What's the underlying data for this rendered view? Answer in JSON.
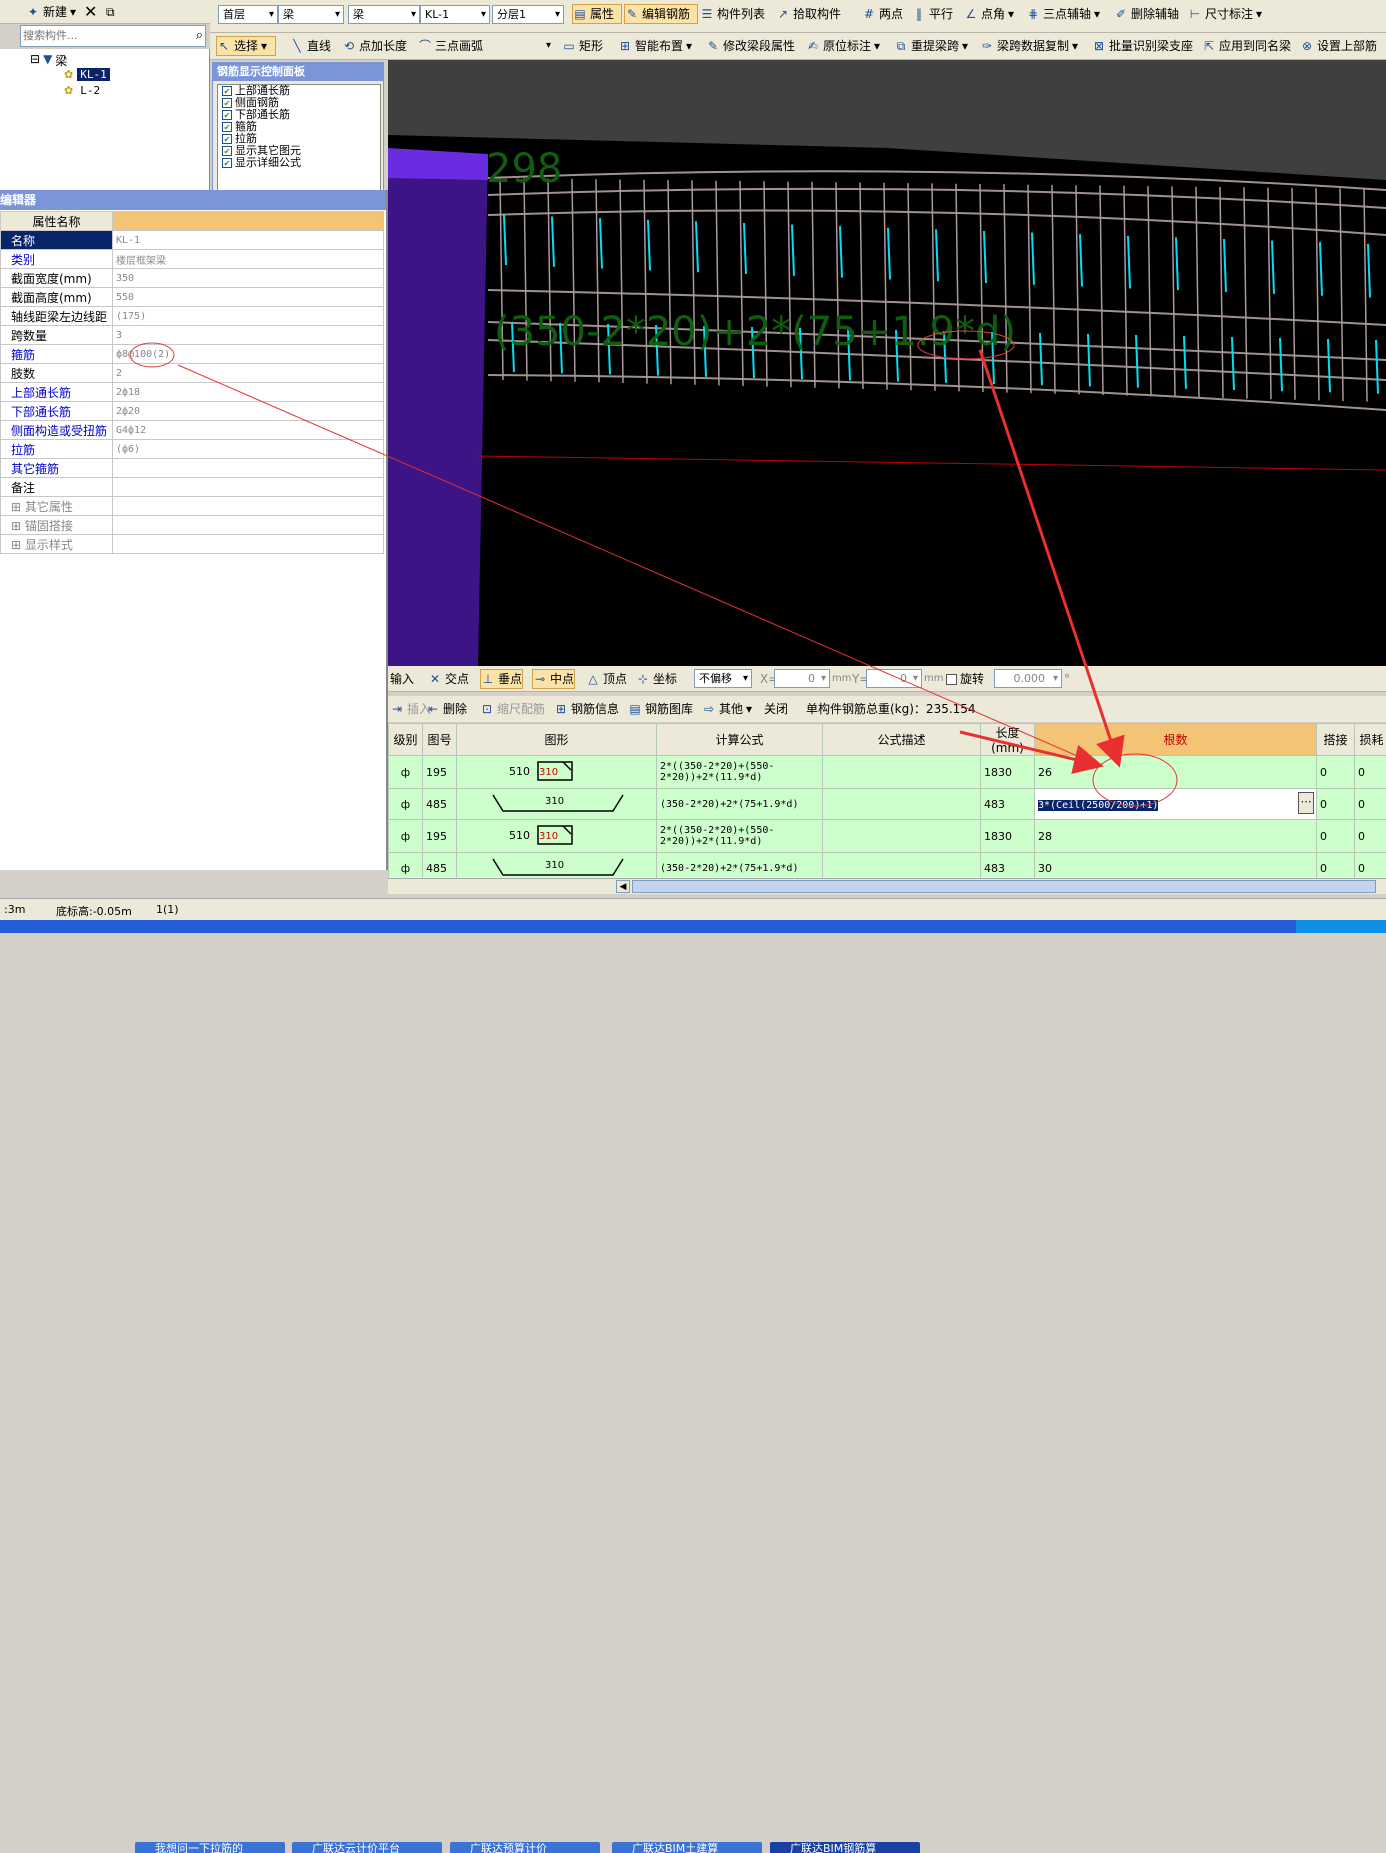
{
  "left_toolbar": {
    "new_label": "新建",
    "search_placeholder": "搜索构件..."
  },
  "tree": {
    "root": "梁",
    "items": [
      "KL-1",
      "L-2"
    ]
  },
  "toolbar1": {
    "floor": "首层",
    "cat1": "梁",
    "cat2": "梁",
    "component": "KL-1",
    "layer": "分层1",
    "attr": "属性",
    "edit_rebar": "编辑钢筋",
    "comp_list": "构件列表",
    "pick": "拾取构件",
    "two_point": "两点",
    "parallel": "平行",
    "point_angle": "点角",
    "three_point_aux": "三点辅轴",
    "delete_aux": "删除辅轴",
    "dimension": "尺寸标注"
  },
  "toolbar2": {
    "select": "选择",
    "line": "直线",
    "point_len": "点加长度",
    "arc": "三点画弧",
    "rect": "矩形",
    "smart": "智能布置",
    "modify_span": "修改梁段属性",
    "origin_mark": "原位标注",
    "re_extract": "重提梁跨",
    "copy_span": "梁跨数据复制",
    "batch_support": "批量识别梁支座",
    "apply_same": "应用到同名梁",
    "set_upper": "设置上部筋"
  },
  "control_panel": {
    "title": "钢筋显示控制面板",
    "items": [
      "上部通长筋",
      "侧面钢筋",
      "下部通长筋",
      "箍筋",
      "拉筋",
      "显示其它图元",
      "显示详细公式"
    ]
  },
  "prop_editor": {
    "title": "编辑器",
    "header": "属性名称",
    "rows": [
      {
        "name": "名称",
        "value": "KL-1"
      },
      {
        "name": "类别",
        "value": "楼层框架梁"
      },
      {
        "name": "截面宽度(mm)",
        "value": "350"
      },
      {
        "name": "截面高度(mm)",
        "value": "550"
      },
      {
        "name": "轴线距梁左边线距",
        "value": "(175)"
      },
      {
        "name": "跨数量",
        "value": "3"
      },
      {
        "name": "箍筋",
        "value": "ф8@100(2)"
      },
      {
        "name": "肢数",
        "value": "2"
      },
      {
        "name": "上部通长筋",
        "value": "2ф18"
      },
      {
        "name": "下部通长筋",
        "value": "2ф20"
      },
      {
        "name": "侧面构造或受扭筋",
        "value": "G4ф12"
      },
      {
        "name": "拉筋",
        "value": "(ф6)"
      },
      {
        "name": "其它箍筋",
        "value": ""
      },
      {
        "name": "备注",
        "value": ""
      },
      {
        "name": "其它属性",
        "value": ""
      },
      {
        "name": "锚固搭接",
        "value": ""
      },
      {
        "name": "显示样式",
        "value": ""
      }
    ]
  },
  "canvas": {
    "label_top": "298",
    "formula": "(350-2*20)+2*(75+1.9*d)"
  },
  "snap_bar": {
    "input": "输入",
    "intersect": "交点",
    "perp": "垂点",
    "mid": "中点",
    "vertex": "顶点",
    "coord": "坐标",
    "no_offset": "不偏移",
    "x_label": "X=",
    "x_val": "0",
    "mm1": "mm",
    "y_label": "Y=",
    "y_val": "0",
    "mm2": "mm",
    "rotate": "旋转",
    "rot_val": "0.000",
    "deg": "°"
  },
  "rebar_bar": {
    "insert": "插入",
    "delete": "删除",
    "scale": "缩尺配筋",
    "rebar_info": "钢筋信息",
    "rebar_lib": "钢筋图库",
    "other": "其他",
    "close": "关闭",
    "total": "单构件钢筋总重(kg)：235.154"
  },
  "grid": {
    "headers": [
      "级别",
      "图号",
      "图形",
      "计算公式",
      "公式描述",
      "长度(mm)",
      "根数",
      "搭接",
      "损耗"
    ],
    "rows": [
      {
        "grade": "ф",
        "fig": "195",
        "s1": "510",
        "s2": "310",
        "formula": "2*((350-2*20)+(550-2*20))+2*(11.9*d)",
        "len": "1830",
        "count": "26",
        "lap": "0",
        "loss": "0"
      },
      {
        "grade": "ф",
        "fig": "485",
        "s1": "",
        "s2": "310",
        "formula": "(350-2*20)+2*(75+1.9*d)",
        "len": "483",
        "count": "3*(Ceil(2500/200)+1)",
        "lap": "0",
        "loss": "0"
      },
      {
        "grade": "ф",
        "fig": "195",
        "s1": "510",
        "s2": "310",
        "formula": "2*((350-2*20)+(550-2*20))+2*(11.9*d)",
        "len": "1830",
        "count": "28",
        "lap": "0",
        "loss": "0"
      },
      {
        "grade": "ф",
        "fig": "485",
        "s1": "",
        "s2": "310",
        "formula": "(350-2*20)+2*(75+1.9*d)",
        "len": "483",
        "count": "30",
        "lap": "0",
        "loss": "0"
      }
    ]
  },
  "status": {
    "s1": ":3m",
    "s2": "底标高:-0.05m",
    "s3": "1(1)"
  },
  "taskbar": [
    "我想问一下拉筋的",
    "广联达云计价平台",
    "广联达预算计价",
    "广联达BIM土建算",
    "广联达BIM钢筋算"
  ]
}
